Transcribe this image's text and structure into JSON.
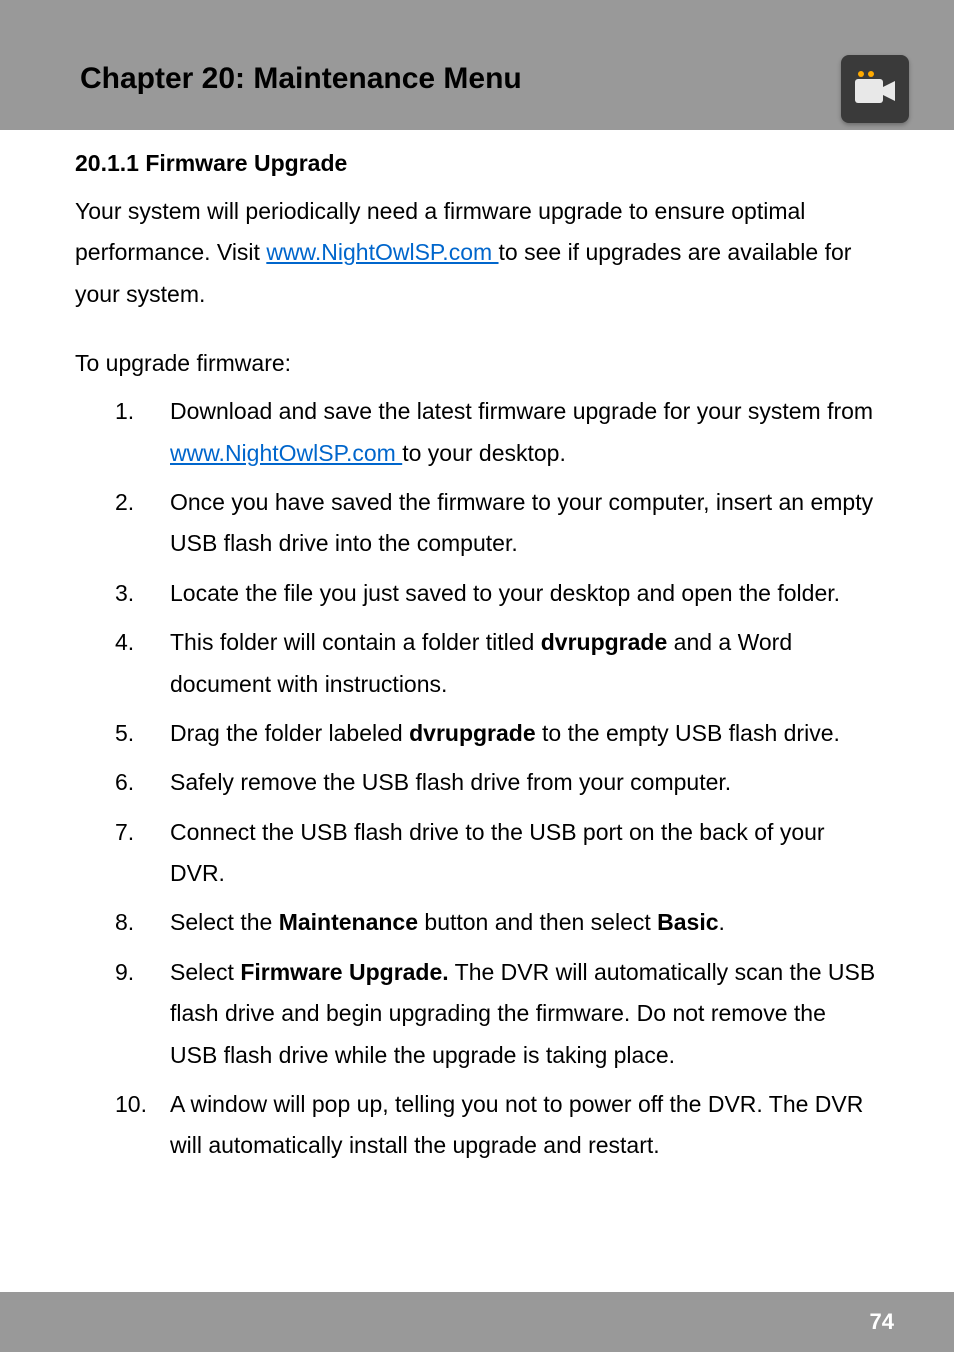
{
  "header": {
    "chapter_title": "Chapter 20: Maintenance Menu"
  },
  "section": {
    "title": "20.1.1 Firmware Upgrade",
    "intro_part1": "Your system will periodically need a firmware upgrade to ensure optimal performance. Visit ",
    "intro_link": "www.NightOwlSP.com ",
    "intro_part2": "to see if upgrades are available for your system.",
    "subhead": "To upgrade firmware:",
    "steps": [
      {
        "num": "1.",
        "parts": [
          {
            "t": "text",
            "v": "Download and save the latest firmware upgrade for your system from "
          },
          {
            "t": "link",
            "v": "www.NightOwlSP.com "
          },
          {
            "t": "text",
            "v": "to your desktop."
          }
        ]
      },
      {
        "num": "2.",
        "parts": [
          {
            "t": "text",
            "v": "Once you have saved the firmware to your computer, insert an empty USB flash drive into the computer."
          }
        ]
      },
      {
        "num": "3.",
        "parts": [
          {
            "t": "text",
            "v": "Locate the file you just saved to your desktop and open the folder."
          }
        ]
      },
      {
        "num": "4.",
        "parts": [
          {
            "t": "text",
            "v": "This folder will contain a folder titled "
          },
          {
            "t": "bold",
            "v": "dvrupgrade"
          },
          {
            "t": "text",
            "v": " and a Word document with instructions."
          }
        ]
      },
      {
        "num": "5.",
        "parts": [
          {
            "t": "text",
            "v": "Drag the folder labeled "
          },
          {
            "t": "bold",
            "v": "dvrupgrade"
          },
          {
            "t": "text",
            "v": " to the empty USB flash drive."
          }
        ]
      },
      {
        "num": "6.",
        "parts": [
          {
            "t": "text",
            "v": "Safely remove the USB flash drive from your computer."
          }
        ]
      },
      {
        "num": "7.",
        "parts": [
          {
            "t": "text",
            "v": "Connect the USB flash drive to the USB port on the back of your DVR."
          }
        ]
      },
      {
        "num": "8.",
        "parts": [
          {
            "t": "text",
            "v": "Select the "
          },
          {
            "t": "bold",
            "v": "Maintenance"
          },
          {
            "t": "text",
            "v": " button and then select "
          },
          {
            "t": "bold",
            "v": "Basic"
          },
          {
            "t": "text",
            "v": "."
          }
        ]
      },
      {
        "num": "9.",
        "parts": [
          {
            "t": "text",
            "v": "Select "
          },
          {
            "t": "bold",
            "v": "Firmware Upgrade."
          },
          {
            "t": "text",
            "v": " The DVR will automatically scan the USB flash drive and begin upgrading the firmware. Do not remove the USB flash drive while the upgrade is taking place."
          }
        ]
      },
      {
        "num": "10.",
        "parts": [
          {
            "t": "text",
            "v": "A window will pop up, telling you not to power off the DVR. The DVR will automatically install the upgrade and restart."
          }
        ]
      }
    ]
  },
  "footer": {
    "page_number": "74"
  }
}
